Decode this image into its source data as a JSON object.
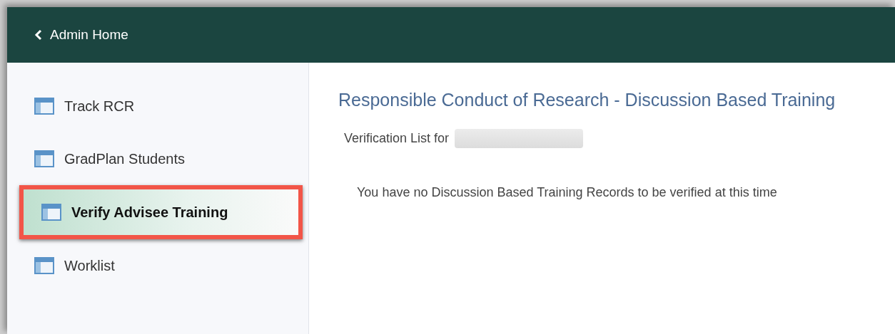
{
  "header": {
    "back_label": "Admin Home"
  },
  "sidebar": {
    "items": [
      {
        "label": "Track RCR",
        "selected": false,
        "highlighted": false
      },
      {
        "label": "GradPlan Students",
        "selected": false,
        "highlighted": false
      },
      {
        "label": "Verify Advisee Training",
        "selected": true,
        "highlighted": true
      },
      {
        "label": "Worklist",
        "selected": false,
        "highlighted": false
      }
    ]
  },
  "content": {
    "title": "Responsible Conduct of Research - Discussion Based Training",
    "verification_label": "Verification List for",
    "message": "You have no Discussion Based Training Records to be verified at this time"
  }
}
